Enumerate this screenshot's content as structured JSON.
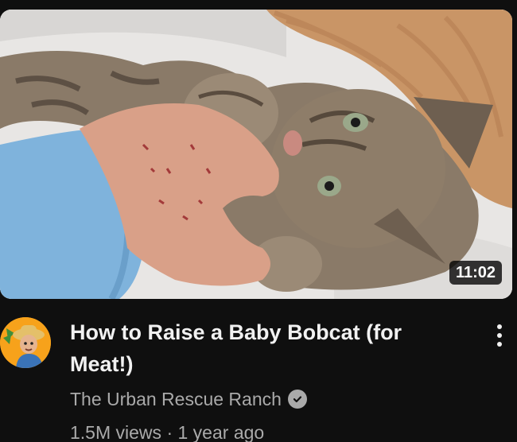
{
  "video": {
    "duration": "11:02",
    "title": "How to Raise a Baby Bobcat (for Meat!)",
    "channel": "The Urban Rescue Ranch",
    "views": "1.5M views",
    "separator": "·",
    "age": "1 year ago"
  },
  "icons": {
    "verified": "verified-check-icon",
    "more": "more-vert-icon"
  },
  "colors": {
    "background": "#0f0f0f",
    "title": "#f1f1f1",
    "secondary_text": "#aaaaaa",
    "avatar_bg": "#f7a21b"
  }
}
